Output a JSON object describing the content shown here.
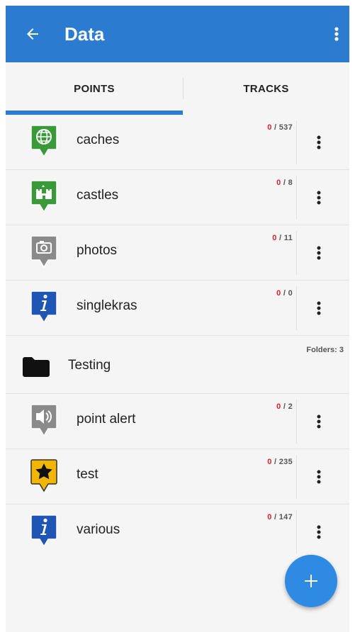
{
  "appbar": {
    "title": "Data",
    "back_icon": "arrow-left-icon",
    "menu_icon": "more-vertical-icon"
  },
  "tabs": [
    {
      "label": "POINTS",
      "selected": true
    },
    {
      "label": "TRACKS",
      "selected": false
    }
  ],
  "list": [
    {
      "name": "caches",
      "visible": "0",
      "total": "/ 537",
      "icon": "globe-icon",
      "color": "#3a9a3a"
    },
    {
      "name": "castles",
      "visible": "0",
      "total": "/ 8",
      "icon": "castle-icon",
      "color": "#3a9a3a"
    },
    {
      "name": "photos",
      "visible": "0",
      "total": "/ 11",
      "icon": "camera-icon",
      "color": "#8a8a8a"
    },
    {
      "name": "singlekras",
      "visible": "0",
      "total": "/ 0",
      "icon": "info-icon",
      "color": "#1f56b5"
    },
    {
      "folder": true,
      "name": "Testing",
      "folders": "Folders: 3",
      "icon": "folder-icon"
    },
    {
      "name": "point alert",
      "visible": "0",
      "total": "/ 2",
      "icon": "speaker-icon",
      "color": "#8a8a8a"
    },
    {
      "name": "test",
      "visible": "0",
      "total": "/ 235",
      "icon": "star-icon",
      "color": "#f2b500"
    },
    {
      "name": "various",
      "visible": "0",
      "total": "/ 147",
      "icon": "info-icon",
      "color": "#1f56b5"
    }
  ],
  "fab": {
    "icon": "plus-icon"
  }
}
